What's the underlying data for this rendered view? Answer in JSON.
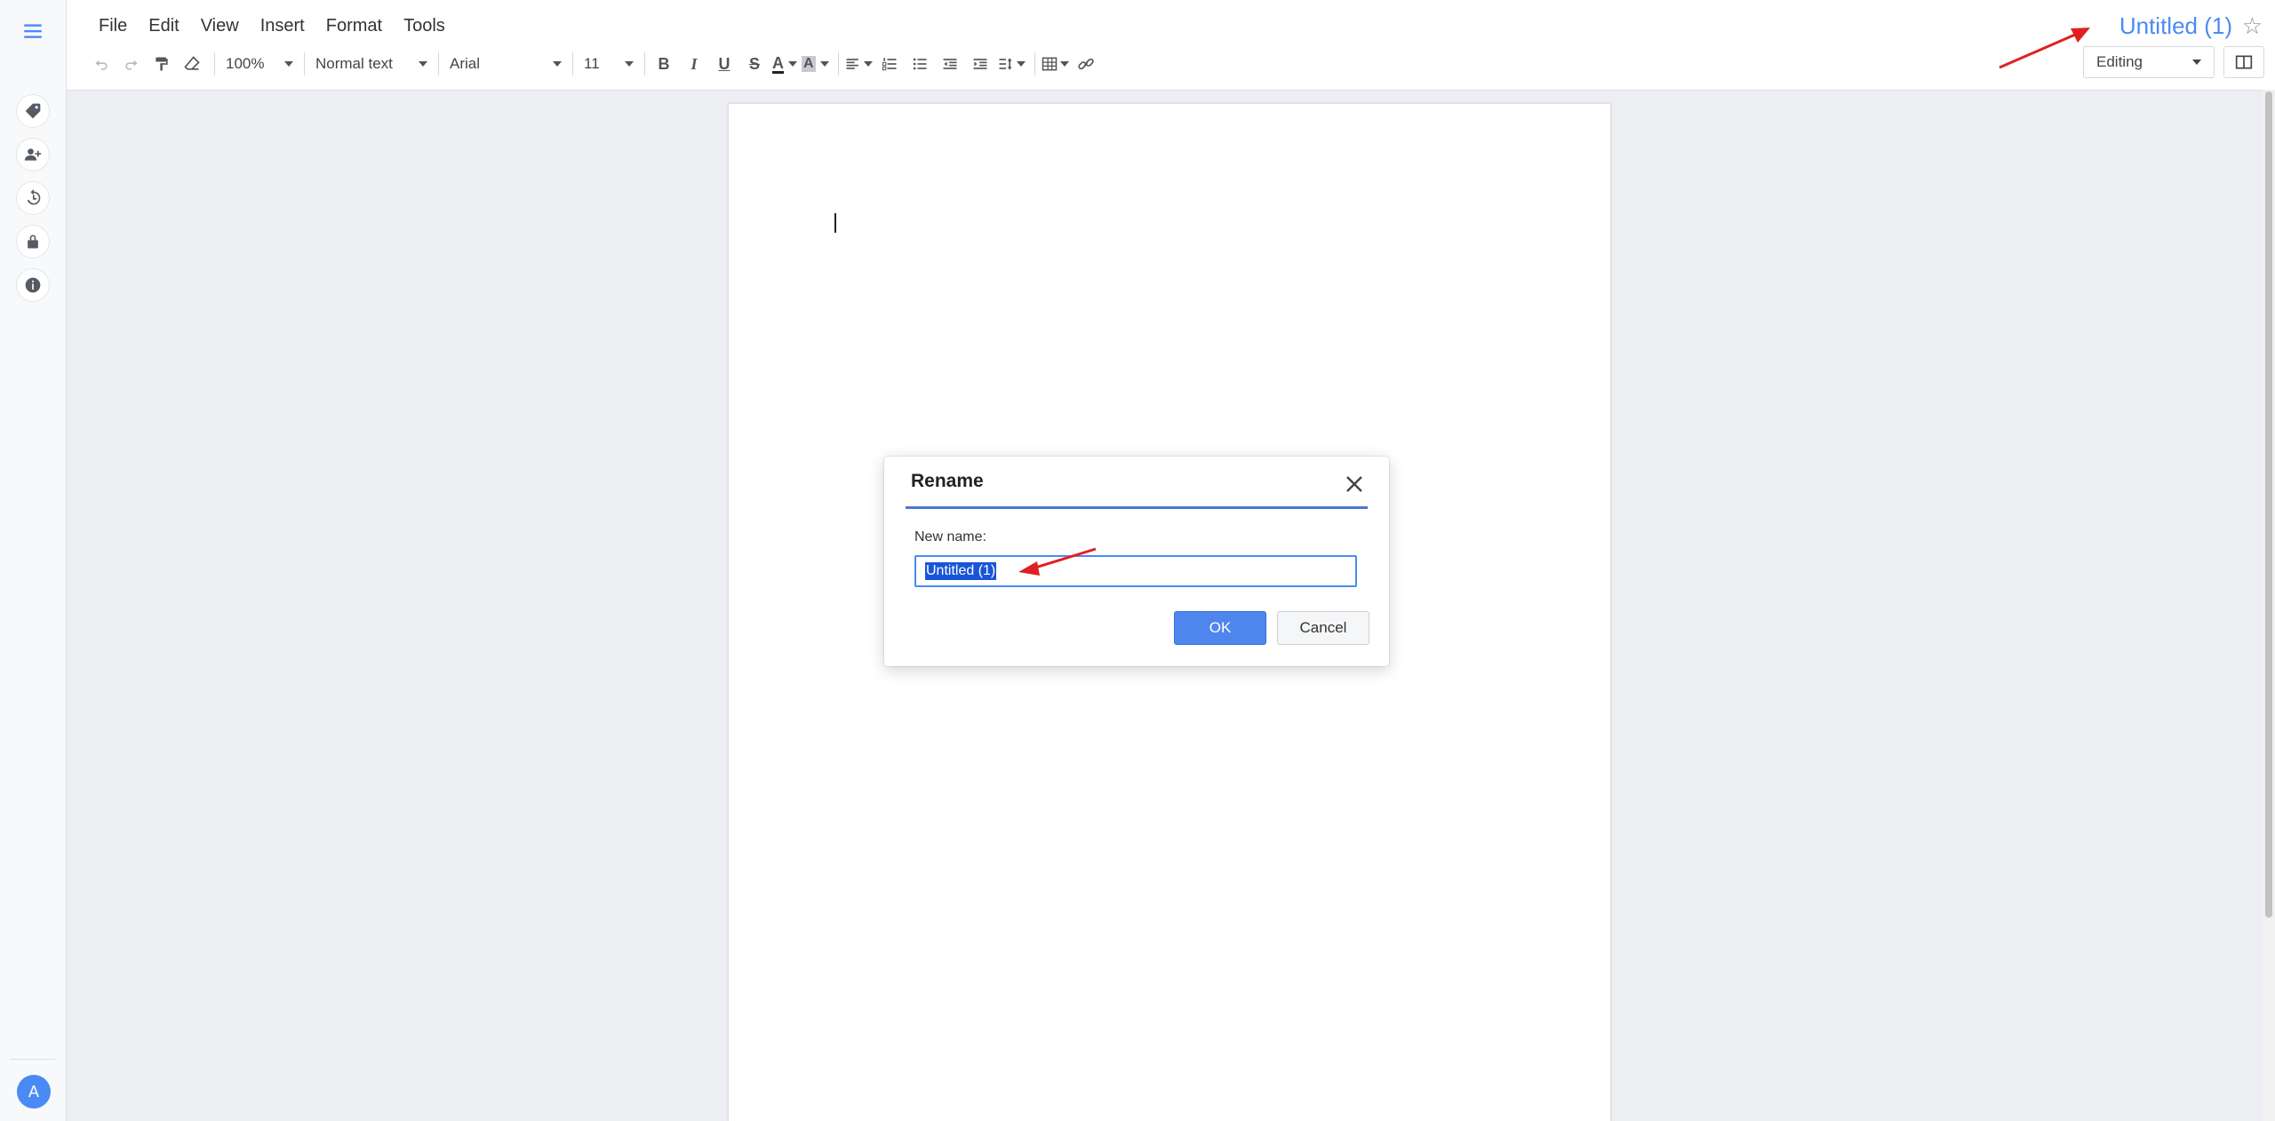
{
  "menubar": {
    "items": [
      "File",
      "Edit",
      "View",
      "Insert",
      "Format",
      "Tools"
    ]
  },
  "toolbar": {
    "zoom": "100%",
    "paragraph_style": "Normal text",
    "font": "Arial",
    "font_size": "11",
    "bold_label": "B",
    "italic_label": "I",
    "underline_label": "U",
    "strike_label": "S",
    "text_color_label": "A",
    "highlight_label": "A"
  },
  "header": {
    "document_title": "Untitled (1)",
    "mode": "Editing",
    "star_icon": "☆"
  },
  "rail": {
    "avatar_initial": "A",
    "icons": [
      "tag-icon",
      "add-person-icon",
      "history-icon",
      "lock-icon",
      "info-icon"
    ]
  },
  "dialog": {
    "title": "Rename",
    "field_label": "New name:",
    "field_value": "Untitled (1)",
    "ok_label": "OK",
    "cancel_label": "Cancel"
  },
  "colors": {
    "accent": "#4a8af4",
    "annotation_arrow": "#e02020"
  }
}
